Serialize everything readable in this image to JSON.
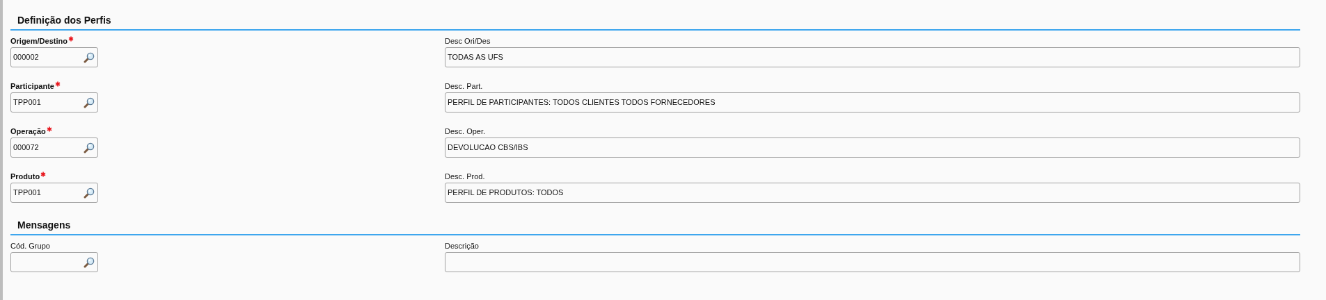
{
  "sections": [
    {
      "title": "Definição dos Perfis",
      "rows": [
        {
          "code": {
            "label": "Origem/Destino",
            "required": true,
            "value": "000002"
          },
          "desc": {
            "label": "Desc Ori/Des",
            "value": "TODAS AS UFS"
          }
        },
        {
          "code": {
            "label": "Participante",
            "required": true,
            "value": "TPP001"
          },
          "desc": {
            "label": "Desc. Part.",
            "value": "PERFIL DE PARTICIPANTES: TODOS CLIENTES TODOS FORNECEDORES"
          }
        },
        {
          "code": {
            "label": "Operação",
            "required": true,
            "value": "000072"
          },
          "desc": {
            "label": "Desc. Oper.",
            "value": "DEVOLUCAO CBS/IBS"
          }
        },
        {
          "code": {
            "label": "Produto",
            "required": true,
            "value": "TPP001"
          },
          "desc": {
            "label": "Desc. Prod.",
            "value": "PERFIL DE PRODUTOS: TODOS"
          }
        }
      ]
    },
    {
      "title": "Mensagens",
      "rows": [
        {
          "code": {
            "label": "Cód. Grupo",
            "required": false
          },
          "desc": {
            "label": "Descrição"
          }
        }
      ]
    }
  ]
}
